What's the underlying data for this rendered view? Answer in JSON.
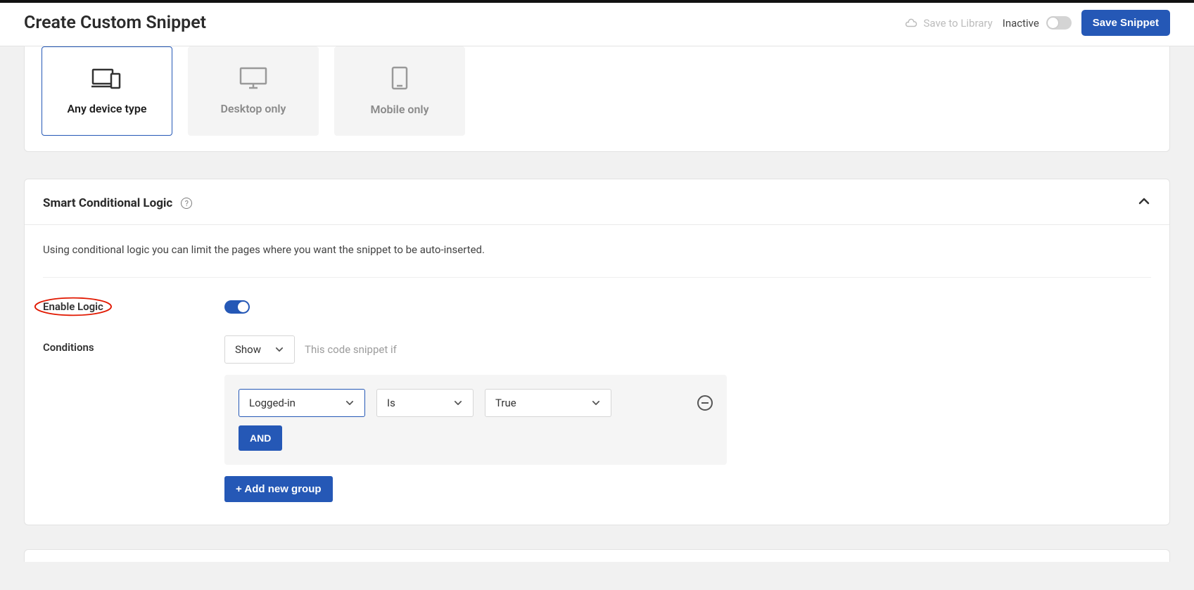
{
  "header": {
    "title": "Create Custom Snippet",
    "save_to_library": "Save to Library",
    "inactive_label": "Inactive",
    "save_button": "Save Snippet"
  },
  "device_type": {
    "options": [
      {
        "label": "Any device type"
      },
      {
        "label": "Desktop only"
      },
      {
        "label": "Mobile only"
      }
    ]
  },
  "scl": {
    "title": "Smart Conditional Logic",
    "description": "Using conditional logic you can limit the pages where you want the snippet to be auto-inserted.",
    "enable_label": "Enable Logic",
    "conditions_label": "Conditions",
    "show_select": "Show",
    "instruction_text": "This code snippet if",
    "cond_field": "Logged-in",
    "cond_op": "Is",
    "cond_value": "True",
    "and_label": "AND",
    "add_group_label": "+ Add new group"
  }
}
